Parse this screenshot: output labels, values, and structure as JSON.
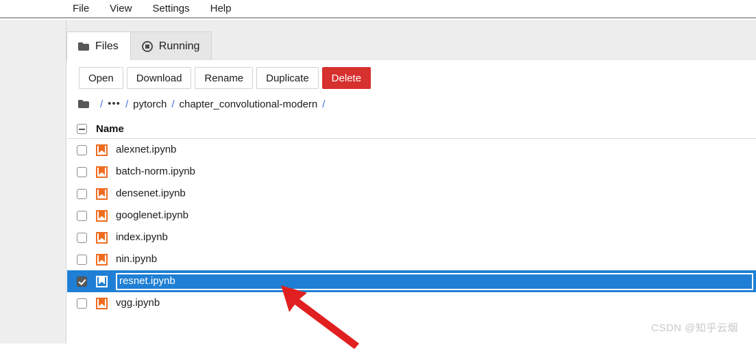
{
  "menubar": {
    "items": [
      {
        "label": "File"
      },
      {
        "label": "View"
      },
      {
        "label": "Settings"
      },
      {
        "label": "Help"
      }
    ]
  },
  "tabs": [
    {
      "label": "Files",
      "icon": "folder-icon",
      "active": true
    },
    {
      "label": "Running",
      "icon": "circle-stop-icon",
      "active": false
    }
  ],
  "toolbar": {
    "open_label": "Open",
    "download_label": "Download",
    "rename_label": "Rename",
    "duplicate_label": "Duplicate",
    "delete_label": "Delete",
    "delete_color": "#d6302f"
  },
  "breadcrumb": {
    "folder_icon": "folder-icon",
    "sep": "/",
    "ellipsis": "•••",
    "segments": [
      "pytorch",
      "chapter_convolutional-modern"
    ]
  },
  "listing": {
    "header": {
      "select_all_state": "indeterminate",
      "name_column": "Name"
    },
    "rows": [
      {
        "name": "alexnet.ipynb",
        "checked": false,
        "selected": false,
        "editing": false
      },
      {
        "name": "batch-norm.ipynb",
        "checked": false,
        "selected": false,
        "editing": false
      },
      {
        "name": "densenet.ipynb",
        "checked": false,
        "selected": false,
        "editing": false
      },
      {
        "name": "googlenet.ipynb",
        "checked": false,
        "selected": false,
        "editing": false
      },
      {
        "name": "index.ipynb",
        "checked": false,
        "selected": false,
        "editing": false
      },
      {
        "name": "nin.ipynb",
        "checked": false,
        "selected": false,
        "editing": false
      },
      {
        "name": "resnet.ipynb",
        "checked": true,
        "selected": true,
        "editing": true
      },
      {
        "name": "vgg.ipynb",
        "checked": false,
        "selected": false,
        "editing": false
      }
    ],
    "selection_color": "#1f7fd4"
  },
  "annotation": {
    "arrow_color": "#e02020"
  },
  "watermark": {
    "text": "CSDN @知乎云烟"
  }
}
